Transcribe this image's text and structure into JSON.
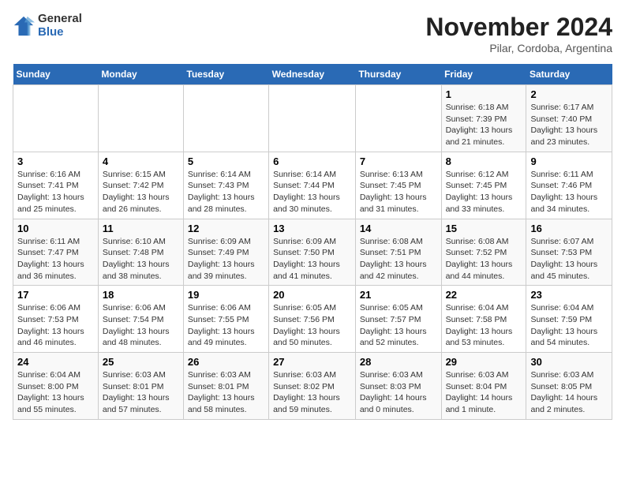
{
  "logo": {
    "general": "General",
    "blue": "Blue"
  },
  "title": "November 2024",
  "location": "Pilar, Cordoba, Argentina",
  "days_of_week": [
    "Sunday",
    "Monday",
    "Tuesday",
    "Wednesday",
    "Thursday",
    "Friday",
    "Saturday"
  ],
  "weeks": [
    [
      {
        "day": "",
        "info": ""
      },
      {
        "day": "",
        "info": ""
      },
      {
        "day": "",
        "info": ""
      },
      {
        "day": "",
        "info": ""
      },
      {
        "day": "",
        "info": ""
      },
      {
        "day": "1",
        "info": "Sunrise: 6:18 AM\nSunset: 7:39 PM\nDaylight: 13 hours\nand 21 minutes."
      },
      {
        "day": "2",
        "info": "Sunrise: 6:17 AM\nSunset: 7:40 PM\nDaylight: 13 hours\nand 23 minutes."
      }
    ],
    [
      {
        "day": "3",
        "info": "Sunrise: 6:16 AM\nSunset: 7:41 PM\nDaylight: 13 hours\nand 25 minutes."
      },
      {
        "day": "4",
        "info": "Sunrise: 6:15 AM\nSunset: 7:42 PM\nDaylight: 13 hours\nand 26 minutes."
      },
      {
        "day": "5",
        "info": "Sunrise: 6:14 AM\nSunset: 7:43 PM\nDaylight: 13 hours\nand 28 minutes."
      },
      {
        "day": "6",
        "info": "Sunrise: 6:14 AM\nSunset: 7:44 PM\nDaylight: 13 hours\nand 30 minutes."
      },
      {
        "day": "7",
        "info": "Sunrise: 6:13 AM\nSunset: 7:45 PM\nDaylight: 13 hours\nand 31 minutes."
      },
      {
        "day": "8",
        "info": "Sunrise: 6:12 AM\nSunset: 7:45 PM\nDaylight: 13 hours\nand 33 minutes."
      },
      {
        "day": "9",
        "info": "Sunrise: 6:11 AM\nSunset: 7:46 PM\nDaylight: 13 hours\nand 34 minutes."
      }
    ],
    [
      {
        "day": "10",
        "info": "Sunrise: 6:11 AM\nSunset: 7:47 PM\nDaylight: 13 hours\nand 36 minutes."
      },
      {
        "day": "11",
        "info": "Sunrise: 6:10 AM\nSunset: 7:48 PM\nDaylight: 13 hours\nand 38 minutes."
      },
      {
        "day": "12",
        "info": "Sunrise: 6:09 AM\nSunset: 7:49 PM\nDaylight: 13 hours\nand 39 minutes."
      },
      {
        "day": "13",
        "info": "Sunrise: 6:09 AM\nSunset: 7:50 PM\nDaylight: 13 hours\nand 41 minutes."
      },
      {
        "day": "14",
        "info": "Sunrise: 6:08 AM\nSunset: 7:51 PM\nDaylight: 13 hours\nand 42 minutes."
      },
      {
        "day": "15",
        "info": "Sunrise: 6:08 AM\nSunset: 7:52 PM\nDaylight: 13 hours\nand 44 minutes."
      },
      {
        "day": "16",
        "info": "Sunrise: 6:07 AM\nSunset: 7:53 PM\nDaylight: 13 hours\nand 45 minutes."
      }
    ],
    [
      {
        "day": "17",
        "info": "Sunrise: 6:06 AM\nSunset: 7:53 PM\nDaylight: 13 hours\nand 46 minutes."
      },
      {
        "day": "18",
        "info": "Sunrise: 6:06 AM\nSunset: 7:54 PM\nDaylight: 13 hours\nand 48 minutes."
      },
      {
        "day": "19",
        "info": "Sunrise: 6:06 AM\nSunset: 7:55 PM\nDaylight: 13 hours\nand 49 minutes."
      },
      {
        "day": "20",
        "info": "Sunrise: 6:05 AM\nSunset: 7:56 PM\nDaylight: 13 hours\nand 50 minutes."
      },
      {
        "day": "21",
        "info": "Sunrise: 6:05 AM\nSunset: 7:57 PM\nDaylight: 13 hours\nand 52 minutes."
      },
      {
        "day": "22",
        "info": "Sunrise: 6:04 AM\nSunset: 7:58 PM\nDaylight: 13 hours\nand 53 minutes."
      },
      {
        "day": "23",
        "info": "Sunrise: 6:04 AM\nSunset: 7:59 PM\nDaylight: 13 hours\nand 54 minutes."
      }
    ],
    [
      {
        "day": "24",
        "info": "Sunrise: 6:04 AM\nSunset: 8:00 PM\nDaylight: 13 hours\nand 55 minutes."
      },
      {
        "day": "25",
        "info": "Sunrise: 6:03 AM\nSunset: 8:01 PM\nDaylight: 13 hours\nand 57 minutes."
      },
      {
        "day": "26",
        "info": "Sunrise: 6:03 AM\nSunset: 8:01 PM\nDaylight: 13 hours\nand 58 minutes."
      },
      {
        "day": "27",
        "info": "Sunrise: 6:03 AM\nSunset: 8:02 PM\nDaylight: 13 hours\nand 59 minutes."
      },
      {
        "day": "28",
        "info": "Sunrise: 6:03 AM\nSunset: 8:03 PM\nDaylight: 14 hours\nand 0 minutes."
      },
      {
        "day": "29",
        "info": "Sunrise: 6:03 AM\nSunset: 8:04 PM\nDaylight: 14 hours\nand 1 minute."
      },
      {
        "day": "30",
        "info": "Sunrise: 6:03 AM\nSunset: 8:05 PM\nDaylight: 14 hours\nand 2 minutes."
      }
    ]
  ]
}
